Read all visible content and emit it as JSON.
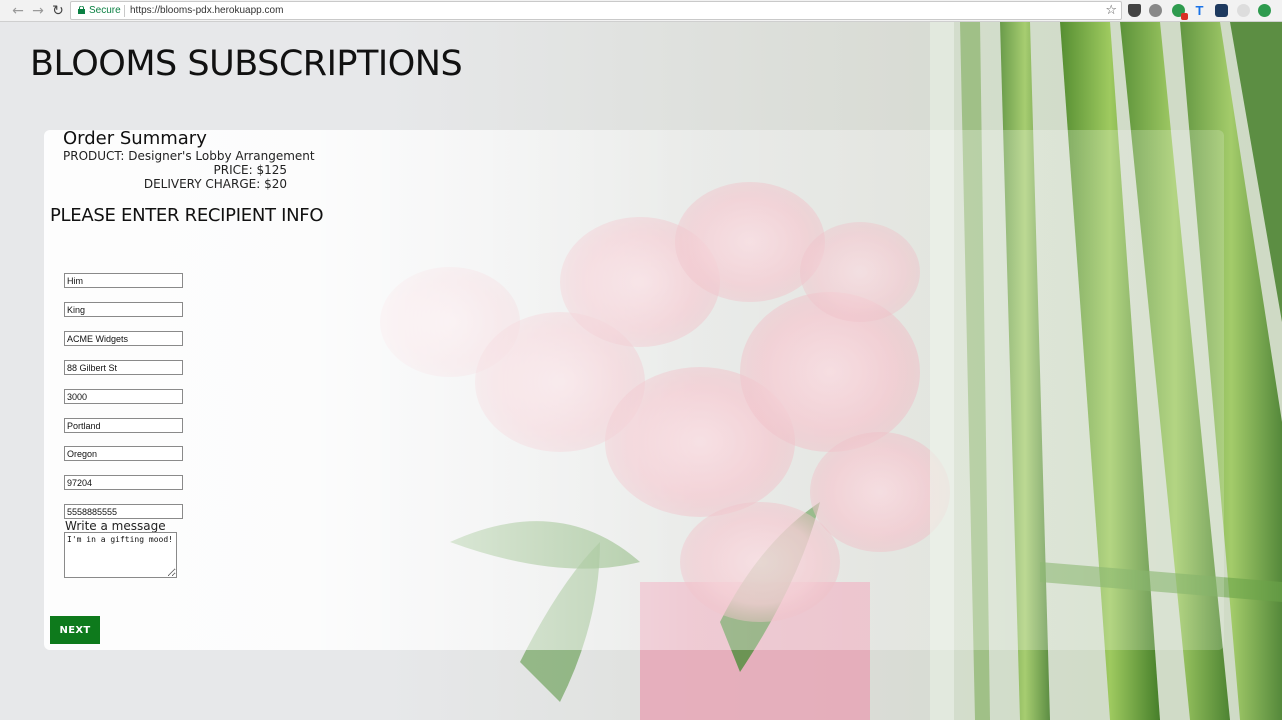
{
  "browser": {
    "secure_label": "Secure",
    "url": "https://blooms-pdx.herokuapp.com"
  },
  "page": {
    "title": "BLOOMS SUBSCRIPTIONS"
  },
  "order_summary": {
    "title": "Order Summary",
    "product": "PRODUCT: Designer's Lobby Arrangement",
    "price": "PRICE: $125",
    "delivery": "DELIVERY CHARGE: $20"
  },
  "recipient": {
    "section_title": "PLEASE ENTER RECIPIENT INFO",
    "first_name": "Him",
    "last_name": "King",
    "company": "ACME Widgets",
    "address": "88 Gilbert St",
    "unit": "3000",
    "city": "Portland",
    "state": "Oregon",
    "zip": "97204",
    "phone": "5558885555",
    "message_label": "Write a message",
    "message": "I'm in a gifting mood!"
  },
  "actions": {
    "next_label": "NEXT"
  },
  "colors": {
    "next_button": "#0e7a1c",
    "secure_green": "#0b8043"
  }
}
